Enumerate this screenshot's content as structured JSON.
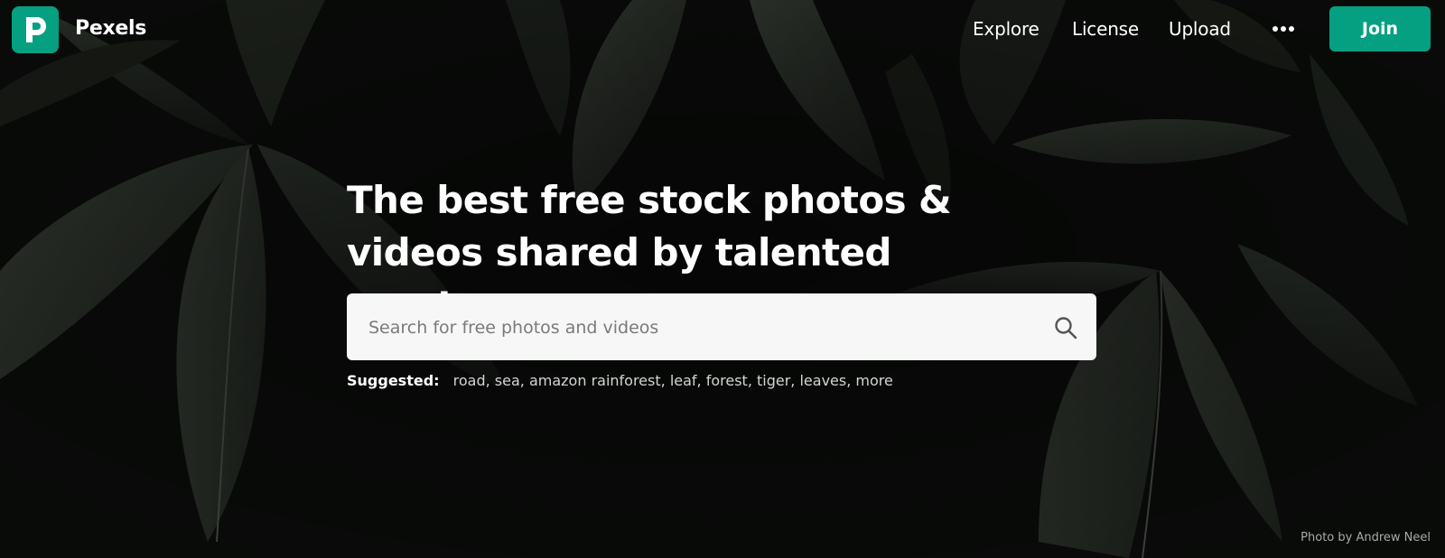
{
  "brand": {
    "name": "Pexels",
    "accent_color": "#05a081"
  },
  "nav": {
    "explore": "Explore",
    "license": "License",
    "upload": "Upload",
    "more_icon": "more-dots-icon",
    "join": "Join"
  },
  "hero": {
    "headline": "The best free stock photos & videos shared by talented creators."
  },
  "search": {
    "placeholder": "Search for free photos and videos",
    "value": "",
    "icon": "search-icon"
  },
  "suggested": {
    "label": "Suggested:",
    "items": [
      "road",
      "sea",
      "amazon rainforest",
      "leaf",
      "forest",
      "tiger",
      "leaves",
      "more"
    ]
  },
  "credit": "Photo by Andrew Neel"
}
